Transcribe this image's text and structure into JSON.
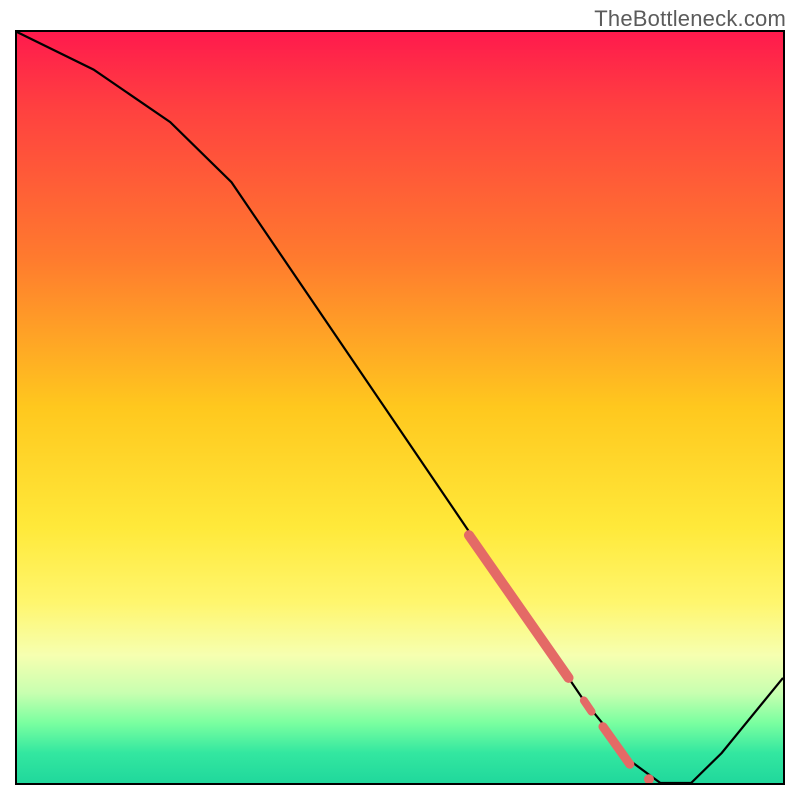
{
  "watermark": "TheBottleneck.com",
  "colors": {
    "line": "#000000",
    "marker": "#e46a66",
    "gradient_top": "#ff1a4d",
    "gradient_bottom": "#20d89c"
  },
  "chart_data": {
    "type": "line",
    "title": "",
    "xlabel": "",
    "ylabel": "",
    "xlim": [
      0,
      100
    ],
    "ylim": [
      0,
      100
    ],
    "grid": false,
    "legend": false,
    "x": [
      0,
      10,
      20,
      28,
      40,
      50,
      60,
      66,
      70,
      74,
      78,
      80,
      84,
      88,
      92,
      100
    ],
    "values": [
      100,
      95,
      88,
      80,
      62,
      47,
      32,
      23,
      17,
      11,
      6,
      3,
      0,
      0,
      4,
      14
    ],
    "highlight_segments": [
      {
        "x0": 59,
        "y0": 33,
        "x1": 72,
        "y1": 14,
        "width": 10
      },
      {
        "x0": 74,
        "y0": 11,
        "x1": 75,
        "y1": 9.5,
        "width": 8
      },
      {
        "x0": 76.5,
        "y0": 7.5,
        "x1": 80,
        "y1": 2.5,
        "width": 9
      }
    ],
    "highlight_points": [
      {
        "x": 82.5,
        "y": 0.5,
        "r": 5
      }
    ]
  }
}
